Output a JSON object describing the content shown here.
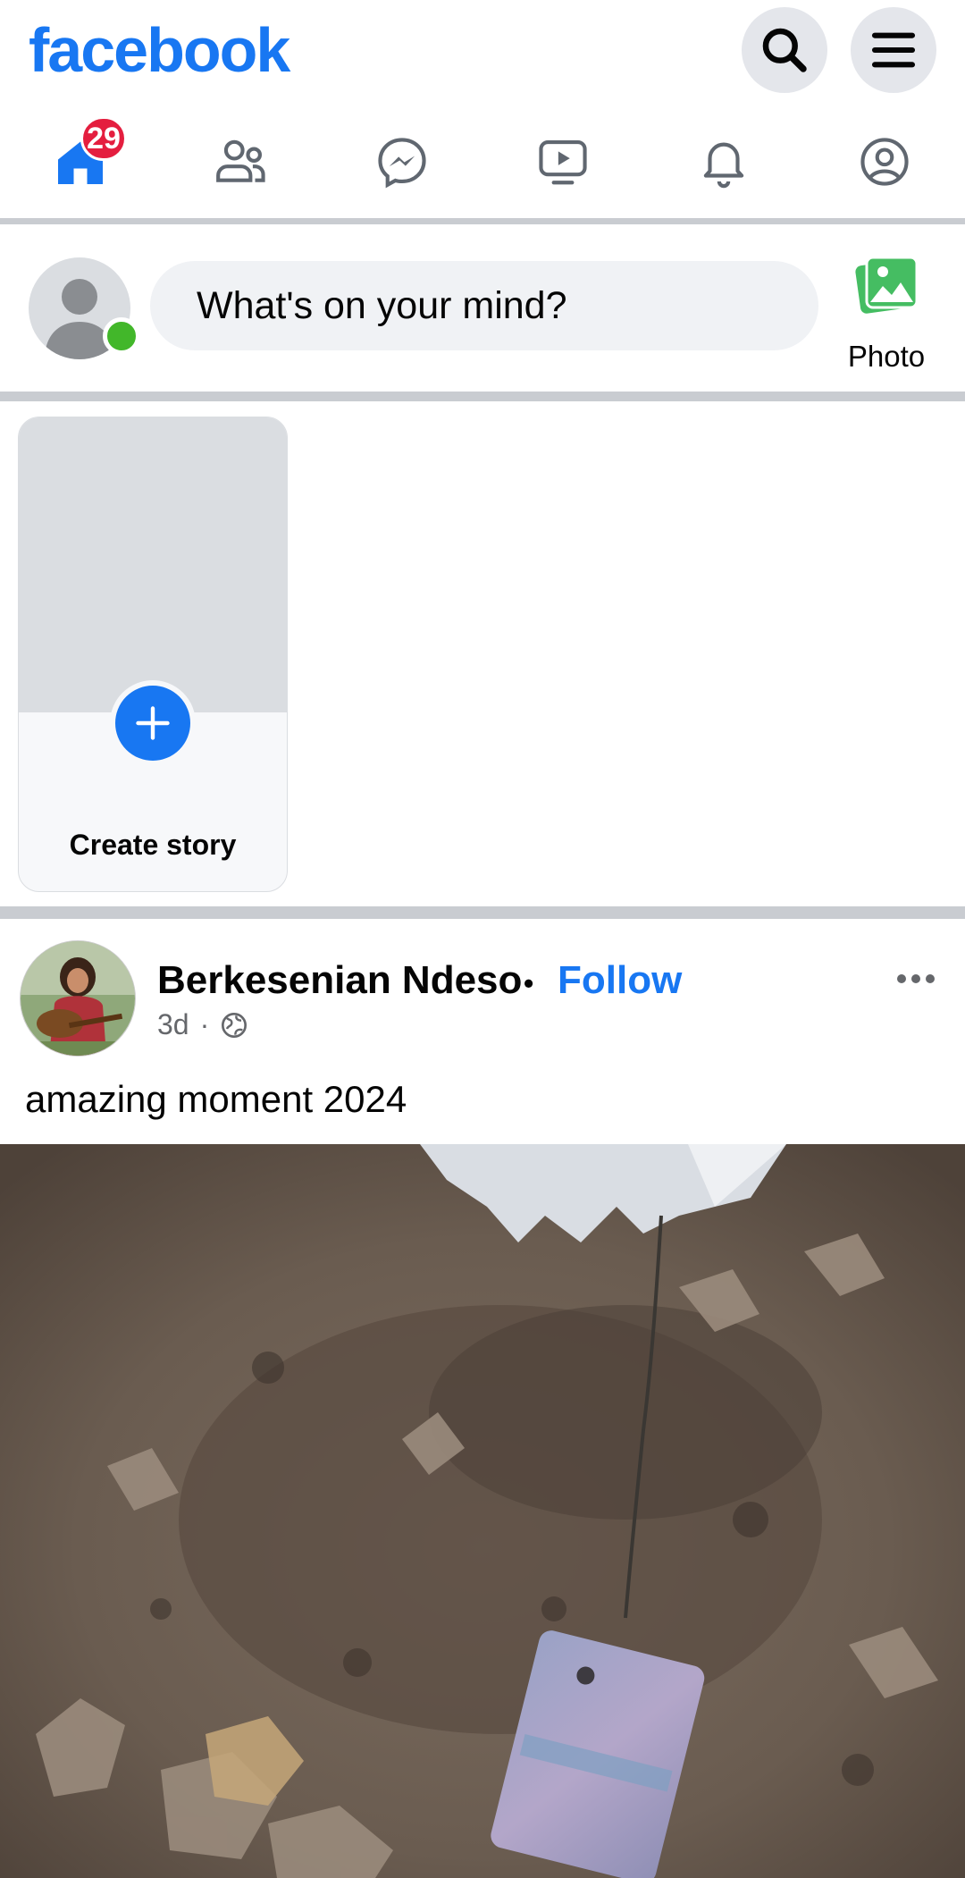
{
  "app": {
    "logo_text": "facebook",
    "brand_color": "#1877f2"
  },
  "header": {
    "icons": [
      "search-icon",
      "menu-icon"
    ]
  },
  "nav": {
    "tabs": [
      {
        "name": "home",
        "icon": "home-icon",
        "badge": "29",
        "active": true
      },
      {
        "name": "friends",
        "icon": "friends-icon"
      },
      {
        "name": "messenger",
        "icon": "messenger-icon"
      },
      {
        "name": "watch",
        "icon": "video-icon"
      },
      {
        "name": "notifications",
        "icon": "bell-icon"
      },
      {
        "name": "profile",
        "icon": "profile-icon"
      }
    ]
  },
  "composer": {
    "placeholder": "What's on your mind?",
    "photo_label": "Photo"
  },
  "stories": {
    "create_label": "Create story"
  },
  "post": {
    "author": "Berkesenian Ndeso",
    "separator": "•",
    "follow_label": "Follow",
    "age": "3d",
    "meta_separator": "·",
    "privacy": "globe-icon",
    "text": "amazing moment 2024"
  }
}
